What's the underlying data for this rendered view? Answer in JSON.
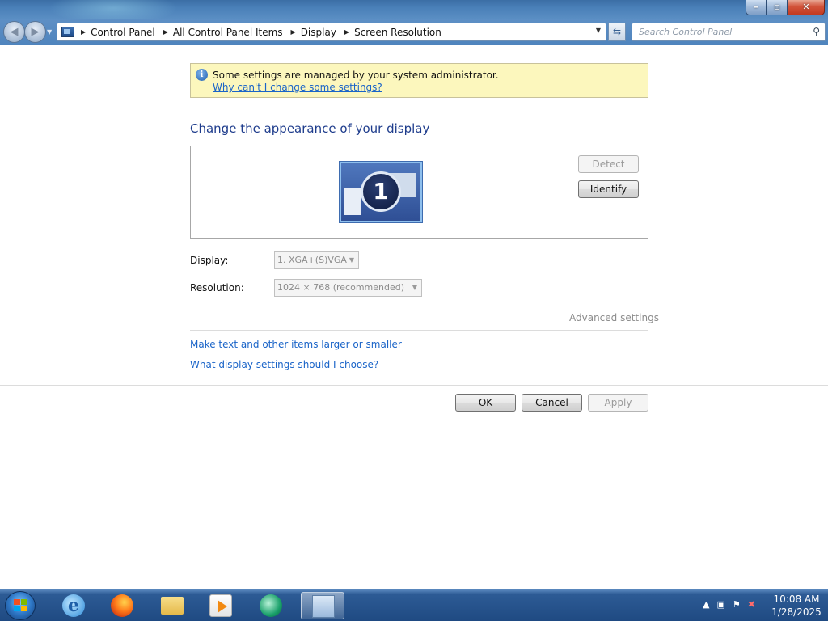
{
  "window": {
    "controls": {
      "minimize": "–",
      "maximize": "▫",
      "close": "✕"
    }
  },
  "address_bar": {
    "breadcrumbs": [
      "Control Panel",
      "All Control Panel Items",
      "Display",
      "Screen Resolution"
    ],
    "search_placeholder": "Search Control Panel"
  },
  "info_bar": {
    "message": "Some settings are managed by your system administrator.",
    "link": "Why can't I change some settings?"
  },
  "main": {
    "heading": "Change the appearance of your display",
    "monitor_number": "1",
    "detect_label": "Detect",
    "identify_label": "Identify",
    "display_label": "Display:",
    "display_value": "1. XGA+(S)VGA",
    "resolution_label": "Resolution:",
    "resolution_value": "1024 × 768 (recommended)",
    "advanced_link": "Advanced settings",
    "link_text_size": "Make text and other items larger or smaller",
    "link_choose": "What display settings should I choose?"
  },
  "buttons": {
    "ok": "OK",
    "cancel": "Cancel",
    "apply": "Apply"
  },
  "taskbar": {
    "clock_time": "10:08 AM",
    "clock_date": "1/28/2025",
    "pinned": [
      "internet-explorer-icon",
      "firefox-icon",
      "folder-icon",
      "media-player-icon",
      "green-app-icon",
      "control-panel-icon"
    ]
  },
  "colors": {
    "link": "#1a64c8",
    "heading": "#1e3c8c",
    "info_bg": "#fcf7bd",
    "taskbar": "#1f4a82"
  }
}
